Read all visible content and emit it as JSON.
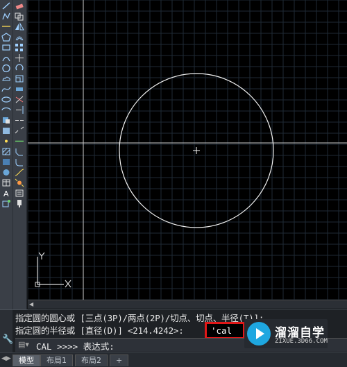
{
  "command_history": {
    "line1": "指定圆的圆心或 [三点(3P)/两点(2P)/切点、切点、半径(T)]:",
    "line2": "指定圆的半径或 [直径(D)] <214.4242>:"
  },
  "cal_input": "'cal",
  "command_line": {
    "prompt": "CAL >>>> 表达式:"
  },
  "tabs": [
    "模型",
    "布局1",
    "布局2"
  ],
  "add_tab_label": "+",
  "ucs": {
    "y_label": "Y",
    "x_label": "X"
  },
  "watermark": {
    "main": "溜溜自学",
    "sub": "ZIXUE.3D66.COM"
  },
  "colors": {
    "highlight_box": "#e01818",
    "canvas_bg": "#000000",
    "grid": "#1f2a36",
    "crosshair": "#d0d0d0",
    "logo_accent": "#1ea7e0"
  }
}
